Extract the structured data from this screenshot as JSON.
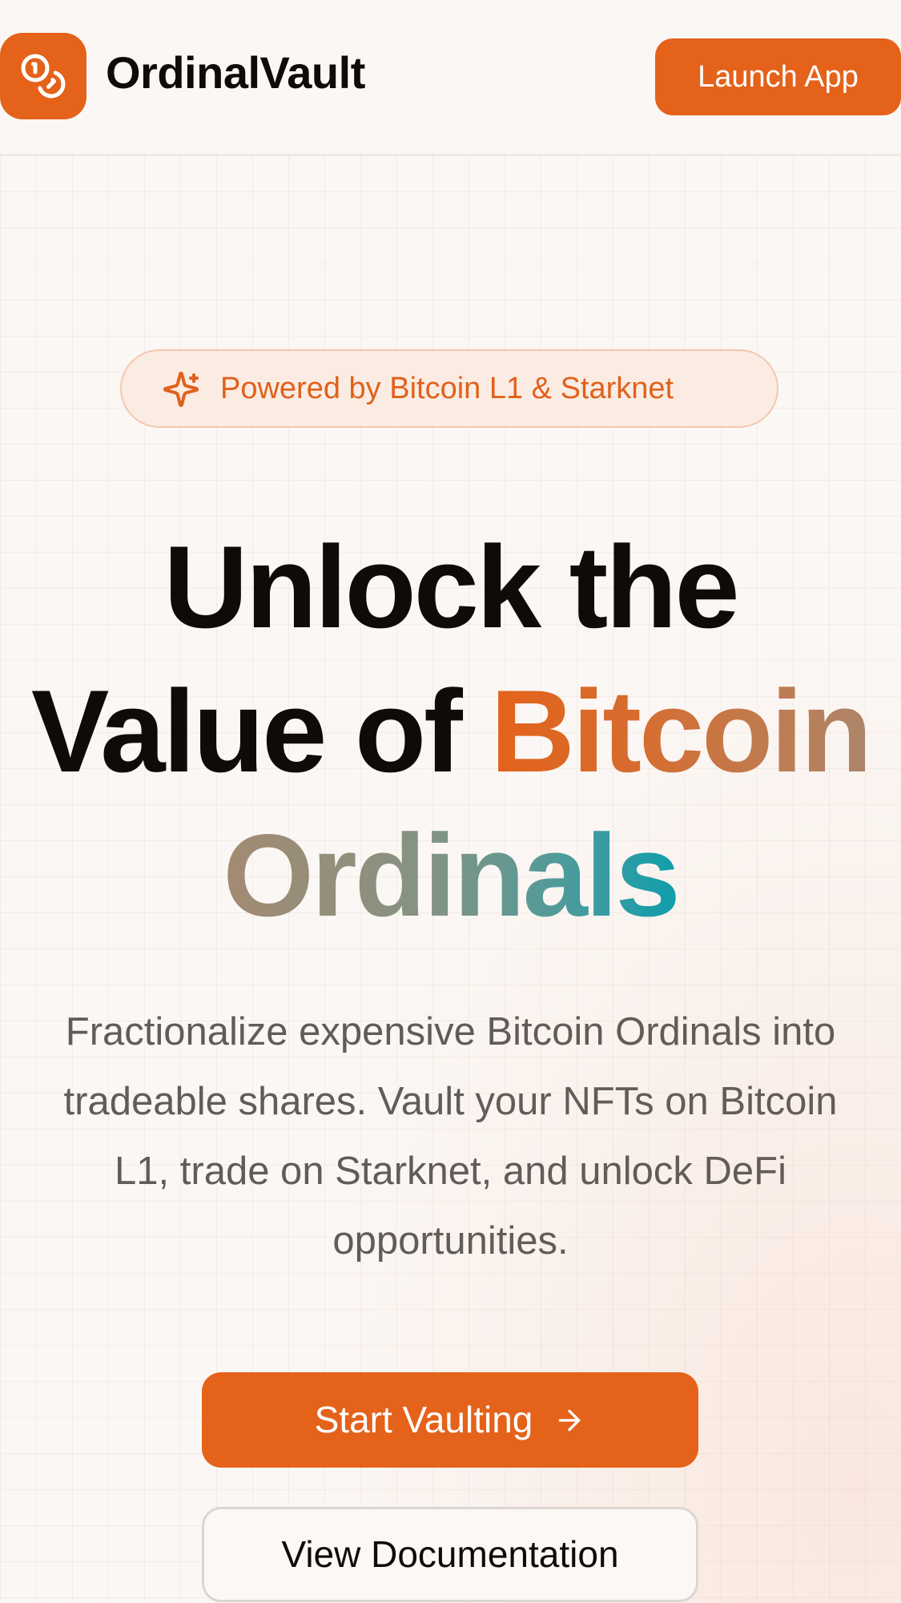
{
  "header": {
    "brand_name": "OrdinalVault",
    "launch_label": "Launch App",
    "logo_icon": "coins-icon"
  },
  "hero": {
    "badge_text": "Powered by Bitcoin L1 & Starknet",
    "badge_icon": "sparkles-icon",
    "headline_line1": "Unlock the",
    "headline_line2_plain": "Value of ",
    "headline_line2_accent": "Bitcoin",
    "headline_line3_accent": "Ordinals",
    "description": "Fractionalize expensive Bitcoin Ordinals into tradeable shares. Vault your NFTs on Bitcoin L1, trade on Starknet, and unlock DeFi opportunities.",
    "primary_cta": "Start Vaulting",
    "primary_cta_icon": "arrow-right-icon",
    "secondary_cta": "View Documentation"
  },
  "colors": {
    "brand": "#e4621a",
    "accent_teal": "#0e9eac",
    "text_dark": "#0e0b09",
    "text_muted": "#625c58",
    "background": "#fbf7f4"
  }
}
